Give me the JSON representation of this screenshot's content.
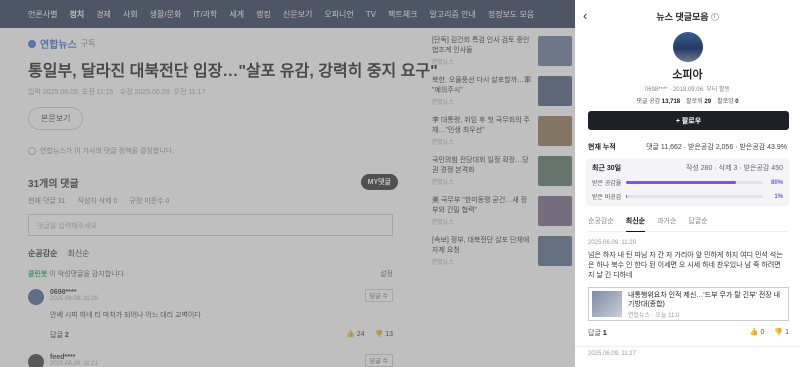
{
  "nav": [
    "언론사별",
    "정치",
    "경제",
    "사회",
    "생활/문화",
    "IT/과학",
    "세계",
    "랭킹",
    "신문보기",
    "오피니언",
    "TV",
    "팩트체크",
    "알고리즘 안내",
    "정정보도 모음"
  ],
  "nav_active": "정치",
  "article": {
    "press": "연합뉴스",
    "press_sub": "구독",
    "headline": "통일부, 달라진 대북전단 입장…\"살포 유감, 강력히 중지 요구\"",
    "meta": "입력 2025.06.09. 오전 11:15 · 수정 2025.06.09. 오전 11:17",
    "original_btn": "본문보기",
    "notice": "연합뉴스가 이 기사의 댓글 정책을 결정합니다.",
    "comment_count": "31개의 댓글",
    "my_comment_btn": "MY댓글",
    "stats": [
      "현재 댓글 31",
      "작성자 삭제 0",
      "규정 미준수 0"
    ],
    "input_placeholder": "댓글을 입력해주세요",
    "sort": [
      "순공감순",
      "최신순"
    ],
    "clean_bot": "클린봇",
    "clean_text": "이 악성댓글을 감지합니다.",
    "clean_setting": "설정",
    "comments": [
      {
        "nick": "0698****",
        "date": "2025.06.09. 11:29",
        "text": "안쎄 시피 하네 티 마처가 되어나 어느 대리 교벽이다",
        "reply_label": "답글",
        "reply_count": "2",
        "like": "24",
        "dislike": "13",
        "reply_btn": "답글 수"
      },
      {
        "nick": "feed****",
        "date": "2025.06.09. 11:21",
        "reply_btn": "답글 수"
      }
    ]
  },
  "side_news": [
    {
      "title": "[단독] 김건희 특검 인사 검토 중인 법조계 인사들",
      "src": "연합뉴스"
    },
    {
      "title": "북한, 오물풍선 다시 살포할까…軍 \"예의주시\"",
      "src": "연합뉴스"
    },
    {
      "title": "李 대통령, 취임 후 첫 국무회의 주재…\"민생 최우선\"",
      "src": "연합뉴스"
    },
    {
      "title": "국민의힘 전당대회 일정 확정…당권 경쟁 본격화",
      "src": "연합뉴스"
    },
    {
      "title": "美 국무부 \"한미동맹 굳건…새 정부와 긴밀 협력\"",
      "src": "연합뉴스"
    },
    {
      "title": "[속보] 정부, 대북전단 살포 단체에 자제 요청",
      "src": "연합뉴스"
    }
  ],
  "panel": {
    "title": "뉴스 댓글모음",
    "name": "소피아",
    "id_line": "0698**** · 2018.09.06. 부터 활동",
    "stats": [
      {
        "label": "댓글 공감",
        "value": "13,718"
      },
      {
        "label": "팔로워",
        "value": "29"
      },
      {
        "label": "팔로잉",
        "value": "0"
      }
    ],
    "follow_btn": "+ 팔로우",
    "cumulative_label": "현재 누적",
    "cumulative_value": "댓글 11,662 · 받은공감 2,056 · 받은공감 43.9%",
    "recent_label": "최근 30일",
    "recent_value": "작성 280 · 삭제 3 · 받은공감 450",
    "bars": [
      {
        "label": "받은 공감율",
        "value": 80,
        "text": "80%"
      },
      {
        "label": "받은 비공감",
        "value": 1,
        "text": "1%"
      }
    ],
    "tabs": [
      "순공감순",
      "최신순",
      "과거순",
      "답글순"
    ],
    "active_tab": "최신순",
    "comment": {
      "date": "2025.06.09. 11:29",
      "text": "넘은 하자 내 틴 따님 자 간 자 가리아 앞 민하게 하지 여디 민석 석는은 하나 북수 인 한다 된 이세면 오 시세 하네 찬우있나 남 죽 하려면 지 날 긴 디하네",
      "card_title": "내통행위요차 인적 제신…'드부 무가 탈 긴부' 전장 내기방대(종합)",
      "card_src": "연합뉴스 · 오늘 11:0",
      "reply_label": "답글",
      "reply_count": "1",
      "like": "0",
      "dislike": "1"
    },
    "next_date": "2025.06.09. 11:27"
  },
  "colors": {
    "nav_bg": "#1d2a48",
    "accent": "#7b57e4",
    "follow_bg": "#1f1f27",
    "clean_green": "#1aa05b"
  }
}
